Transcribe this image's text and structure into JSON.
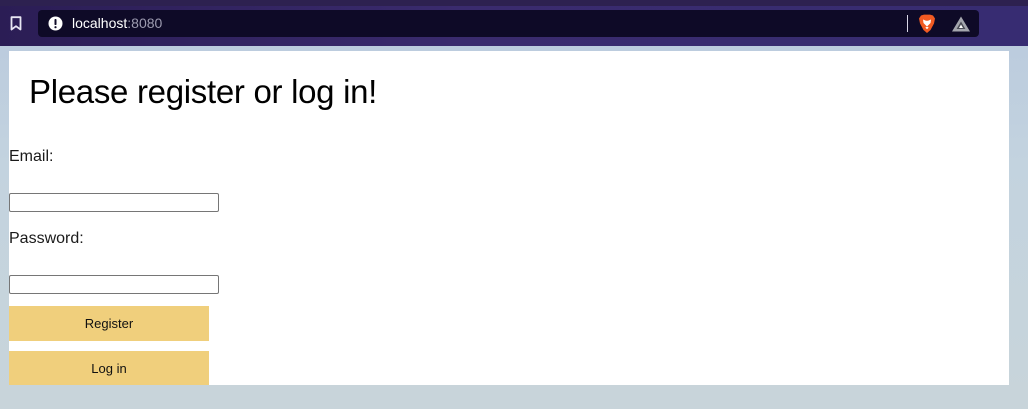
{
  "browser": {
    "url_host": "localhost",
    "url_port": ":8080",
    "icons": {
      "bookmark": "bookmark-icon",
      "site_info": "info-icon",
      "brave_shields": "brave-lion-icon",
      "rewards": "rewards-triangle-icon"
    }
  },
  "page": {
    "heading": "Please register or log in!",
    "email_label": "Email:",
    "email_value": "",
    "password_label": "Password:",
    "password_value": "",
    "register_label": "Register",
    "login_label": "Log in"
  },
  "colors": {
    "button_bg": "#f0cf7c",
    "titlebar": "#2b1d55",
    "urlbar": "#0e0a27"
  }
}
